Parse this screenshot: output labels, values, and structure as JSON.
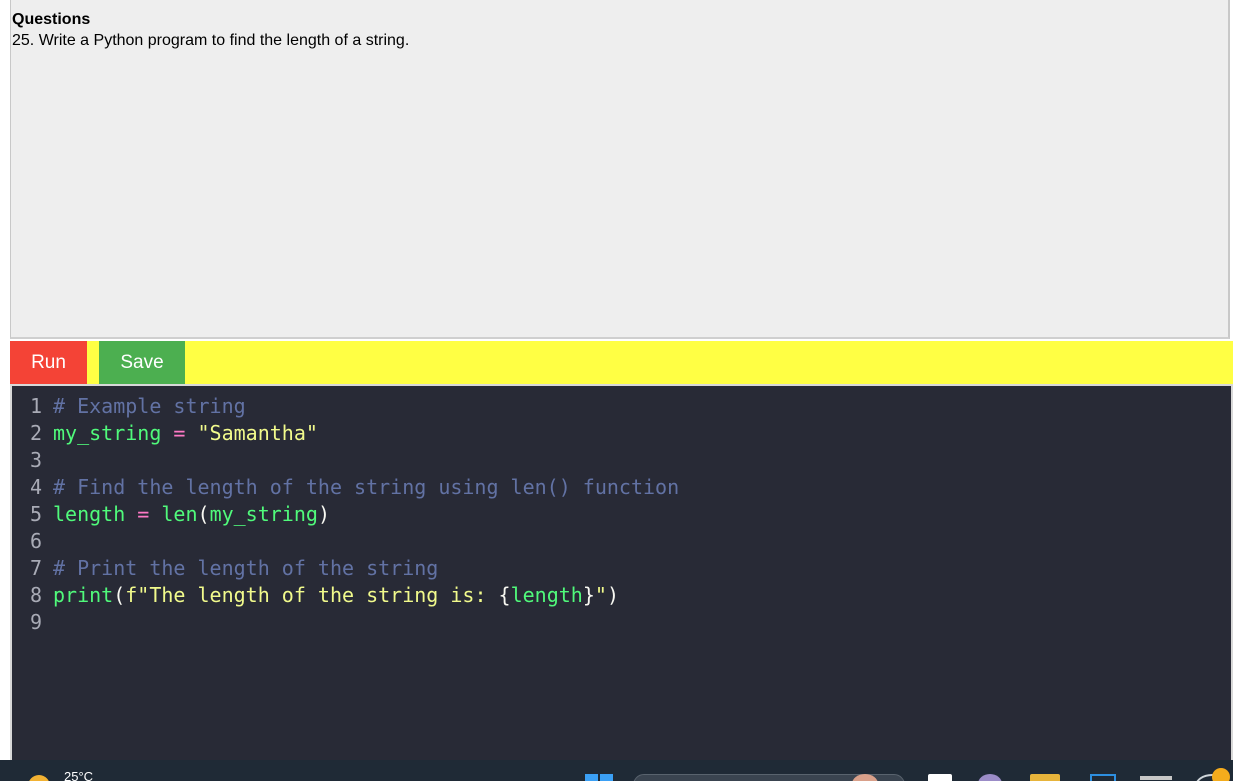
{
  "question": {
    "heading": "Questions",
    "text": "25. Write a Python program to find the length of a string."
  },
  "toolbar": {
    "run_label": "Run",
    "save_label": "Save"
  },
  "editor": {
    "lines": [
      {
        "number": "1",
        "tokens": [
          {
            "t": "# Example string",
            "k": "cm"
          }
        ]
      },
      {
        "number": "2",
        "tokens": [
          {
            "t": "my_string",
            "k": "var"
          },
          {
            "t": " ",
            "k": "plain"
          },
          {
            "t": "=",
            "k": "op"
          },
          {
            "t": " ",
            "k": "plain"
          },
          {
            "t": "\"Samantha\"",
            "k": "str"
          }
        ]
      },
      {
        "number": "3",
        "tokens": []
      },
      {
        "number": "4",
        "tokens": [
          {
            "t": "# Find the length of the string using len() function",
            "k": "cm"
          }
        ]
      },
      {
        "number": "5",
        "tokens": [
          {
            "t": "length",
            "k": "var"
          },
          {
            "t": " ",
            "k": "plain"
          },
          {
            "t": "=",
            "k": "op"
          },
          {
            "t": " ",
            "k": "plain"
          },
          {
            "t": "len",
            "k": "var"
          },
          {
            "t": "(",
            "k": "plain"
          },
          {
            "t": "my_string",
            "k": "var"
          },
          {
            "t": ")",
            "k": "plain"
          }
        ]
      },
      {
        "number": "6",
        "tokens": []
      },
      {
        "number": "7",
        "tokens": [
          {
            "t": "# Print the length of the string",
            "k": "cm"
          }
        ]
      },
      {
        "number": "8",
        "tokens": [
          {
            "t": "print",
            "k": "var"
          },
          {
            "t": "(",
            "k": "plain"
          },
          {
            "t": "f\"The length of the string is: ",
            "k": "str"
          },
          {
            "t": "{",
            "k": "plain"
          },
          {
            "t": "length",
            "k": "var"
          },
          {
            "t": "}",
            "k": "plain"
          },
          {
            "t": "\"",
            "k": "str"
          },
          {
            "t": ")",
            "k": "plain"
          }
        ]
      },
      {
        "number": "9",
        "tokens": []
      }
    ]
  },
  "taskbar": {
    "temperature": "25°C"
  },
  "colors": {
    "run_button": "#f44336",
    "save_button": "#4caf50",
    "toolbar_bg": "#ffff44",
    "editor_bg": "#282a36",
    "comment": "#6272a4",
    "identifier": "#50fa7b",
    "operator": "#ff79c6",
    "string": "#f1fa8c"
  }
}
